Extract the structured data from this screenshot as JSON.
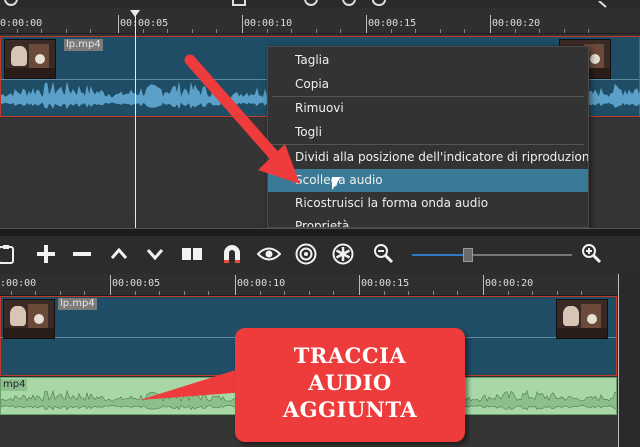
{
  "top_timeline": {
    "ruler_labels": [
      "00:00:00",
      "00:00:05",
      "00:00:10",
      "00:00:15",
      "00:00:20"
    ],
    "clip_name": "lp.mp4"
  },
  "context_menu": {
    "items": [
      {
        "label": "Taglia"
      },
      {
        "label": "Copia"
      },
      {
        "label": "Rimuovi"
      },
      {
        "label": "Togli"
      },
      {
        "label": "Dividi alla posizione dell'indicatore di riproduzione (S"
      },
      {
        "label": "Scollega audio"
      },
      {
        "label": "Ricostruisci la forma onda audio"
      },
      {
        "label": "Proprietà"
      }
    ],
    "highlighted_index": 5
  },
  "toolbar": {
    "buttons": [
      "clipboard-icon",
      "add-icon",
      "remove-icon",
      "up-icon",
      "down-icon",
      "split-icon",
      "snap-magnet-icon",
      "eye-icon",
      "ripple-target-icon",
      "ripple-all-icon",
      "zoom-out-icon",
      "zoom-in-icon"
    ],
    "zoom_level": 0.35
  },
  "bottom_timeline": {
    "ruler_labels": [
      "00:00:00",
      "00:00:05",
      "00:00:10",
      "00:00:15",
      "00:00:20"
    ],
    "video_clip_name": "lp.mp4",
    "audio_clip_name": "mp4"
  },
  "annotation": {
    "callout_text": "TRACCIA\nAUDIO\nAGGIUNTA",
    "colors": {
      "arrow": "#ee3b3b",
      "callout": "#ee3b3b",
      "callout_text": "#ffffff"
    }
  },
  "colors": {
    "timeline_bg": "#2e2e2e",
    "video_clip": "#1f4d66",
    "clip_border": "#c0392b",
    "waveform": "#5aa0c9",
    "audio_clip": "#a7d8a5",
    "menu_highlight": "#3b7a96"
  }
}
